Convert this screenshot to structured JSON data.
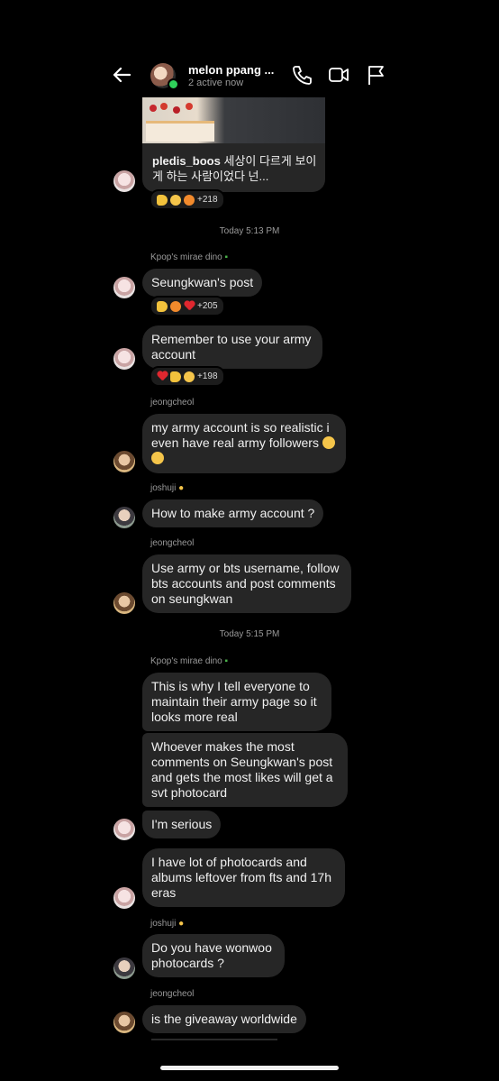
{
  "header": {
    "title": "melon ppang ...",
    "subtitle": "2 active now"
  },
  "shared_post": {
    "username": "pledis_boos",
    "caption": "세상이 다르게 보이게 하는 사람이었다 넌..."
  },
  "reactions": {
    "post": "+218",
    "seungkwan": "+205",
    "remember": "+198"
  },
  "timestamps": [
    "Today 5:13 PM",
    "Today 5:15 PM"
  ],
  "senders": {
    "dino": "Kpop's mirae dino",
    "jeongcheol": "jeongcheol",
    "joshuji": "joshuji"
  },
  "messages": [
    "Seungkwan's post",
    "Remember to use your army account",
    "my army account is so realistic i even have real army followers",
    "How to make army account ?",
    "Use army or bts username, follow bts accounts and post comments on seungkwan",
    "This is why I tell everyone to maintain their army page so it looks more real",
    "Whoever makes the most comments on Seungkwan's post and gets the most likes will get a svt photocard",
    "I'm serious",
    "I have lot of photocards and albums leftover from fts and 17h eras",
    "Do you have wonwoo photocards ?",
    "is the giveaway worldwide"
  ],
  "colors": {
    "background": "#000000",
    "bubble": "#262626",
    "online": "#2fd15a"
  }
}
